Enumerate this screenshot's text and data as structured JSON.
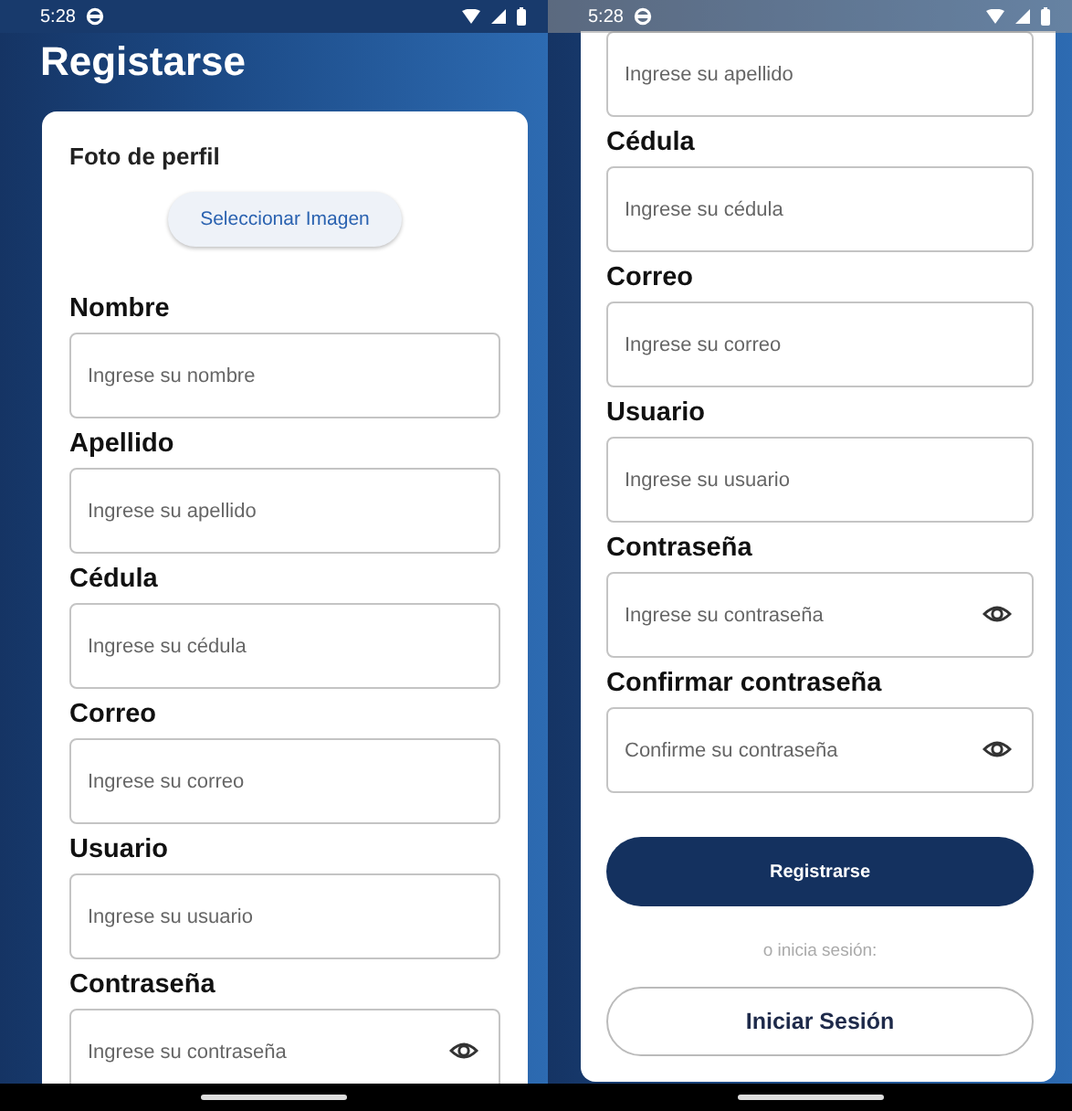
{
  "screens": [
    {
      "status_bar": {
        "time": "5:28",
        "dimmed": false
      },
      "title": "Registarse",
      "photo": {
        "label": "Foto de perfil",
        "button": "Seleccionar Imagen"
      },
      "fields": [
        {
          "label": "Nombre",
          "placeholder": "Ingrese su nombre",
          "kind": "text"
        },
        {
          "label": "Apellido",
          "placeholder": "Ingrese su apellido",
          "kind": "text"
        },
        {
          "label": "Cédula",
          "placeholder": "Ingrese su cédula",
          "kind": "text"
        },
        {
          "label": "Correo",
          "placeholder": "Ingrese su correo",
          "kind": "text"
        },
        {
          "label": "Usuario",
          "placeholder": "Ingrese su usuario",
          "kind": "text"
        },
        {
          "label": "Contraseña",
          "placeholder": "Ingrese su contraseña",
          "kind": "password"
        }
      ]
    },
    {
      "status_bar": {
        "time": "5:28",
        "dimmed": true
      },
      "fields": [
        {
          "placeholder": "Ingrese su apellido",
          "kind": "text"
        },
        {
          "label": "Cédula",
          "placeholder": "Ingrese su cédula",
          "kind": "text"
        },
        {
          "label": "Correo",
          "placeholder": "Ingrese su correo",
          "kind": "text"
        },
        {
          "label": "Usuario",
          "placeholder": "Ingrese su usuario",
          "kind": "text"
        },
        {
          "label": "Contraseña",
          "placeholder": "Ingrese su contraseña",
          "kind": "password"
        },
        {
          "label": "Confirmar contraseña",
          "placeholder": "Confirme su contraseña",
          "kind": "password"
        }
      ],
      "register_button": "Registrarse",
      "alt_text": "o inicia sesión:",
      "login_button": "Iniciar Sesión"
    }
  ]
}
